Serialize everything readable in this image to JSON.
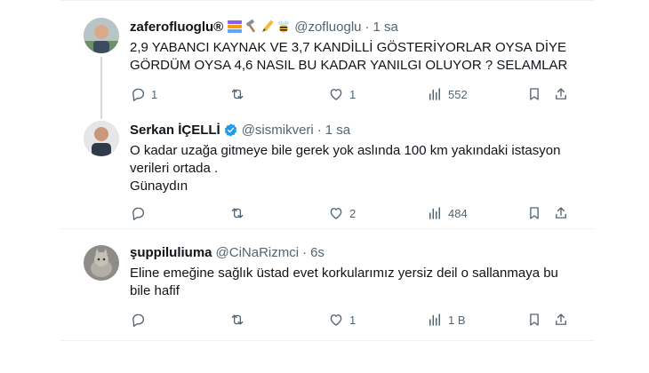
{
  "tweets": [
    {
      "name": "zaferofluoglu®",
      "handle": "@zofluoglu",
      "separator": "·",
      "time": "1 sa",
      "emoji_icons": [
        "stack-icon",
        "hammer-icon",
        "pencil-icon",
        "bee-icon"
      ],
      "text_lines": [
        "2,9 YABANCI KAYNAK VE 3,7 KANDİLLİ GÖSTERİYORLAR OYSA DİYE",
        "GÖRDÜM OYSA 4,6 NASIL BU KADAR YANILGI OLUYOR ? SELAMLAR"
      ],
      "replies": "1",
      "retweets": "",
      "likes": "1",
      "views": "552"
    },
    {
      "name": "Serkan İÇELLİ",
      "handle": "@sismikveri",
      "separator": "·",
      "time": "1 sa",
      "verified": true,
      "text_lines": [
        "O kadar uzağa gitmeye bile gerek yok aslında 100 km yakındaki istasyon",
        "verileri ortada .",
        "Günaydın"
      ],
      "replies": "",
      "retweets": "",
      "likes": "2",
      "views": "484"
    },
    {
      "name": "şuppiluliuma",
      "handle": "@CiNaRizmci",
      "separator": "·",
      "time": "6s",
      "text_lines": [
        "Eline emeğine sağlık üstad evet korkularımız yersiz deil o sallanmaya bu",
        "bile hafif"
      ],
      "replies": "",
      "retweets": "",
      "likes": "1",
      "views": "1 B"
    }
  ],
  "colors": {
    "text": "#0f1419",
    "secondary": "#536471",
    "verified": "#1d9bf0",
    "divider": "#eff3f4"
  }
}
